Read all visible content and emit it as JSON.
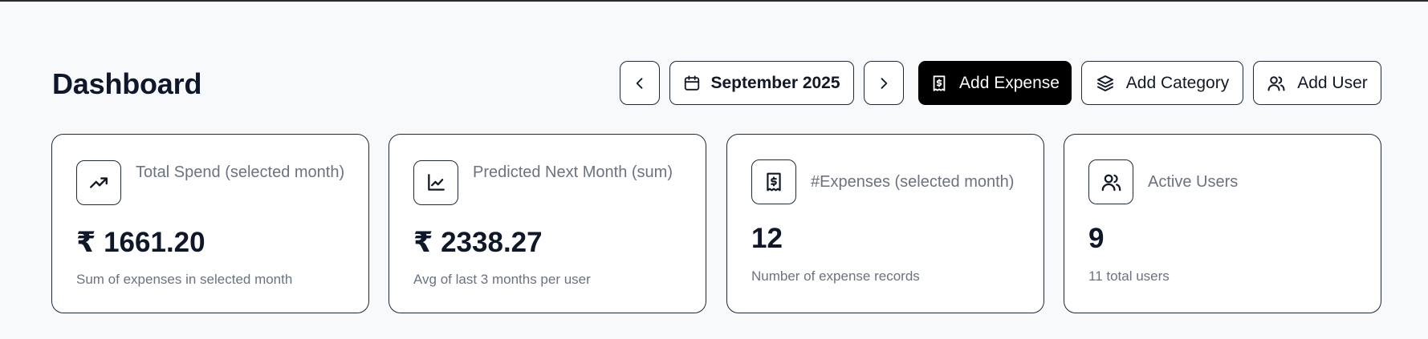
{
  "page": {
    "title": "Dashboard"
  },
  "toolbar": {
    "prev_icon": "chevron-left-icon",
    "month_label": "September 2025",
    "month_icon": "calendar-icon",
    "next_icon": "chevron-right-icon",
    "add_expense_label": "Add Expense",
    "add_expense_icon": "receipt-icon",
    "add_category_label": "Add Category",
    "add_category_icon": "layers-icon",
    "add_user_label": "Add User",
    "add_user_icon": "users-icon"
  },
  "cards": [
    {
      "icon": "trending-up-icon",
      "title": "Total Spend (selected month)",
      "value": "₹ 1661.20",
      "subtitle": "Sum of expenses in selected month"
    },
    {
      "icon": "line-chart-icon",
      "title": "Predicted Next Month (sum)",
      "value": "₹ 2338.27",
      "subtitle": "Avg of last 3 months per user"
    },
    {
      "icon": "receipt-icon",
      "title": "#Expenses (selected month)",
      "value": "12",
      "subtitle": "Number of expense records"
    },
    {
      "icon": "users-icon",
      "title": "Active Users",
      "value": "9",
      "subtitle": "11 total users"
    }
  ],
  "colors": {
    "primary_button": "#000000",
    "background": "#f8f9fb",
    "muted_text": "#6b7280",
    "border": "#1f2937"
  }
}
